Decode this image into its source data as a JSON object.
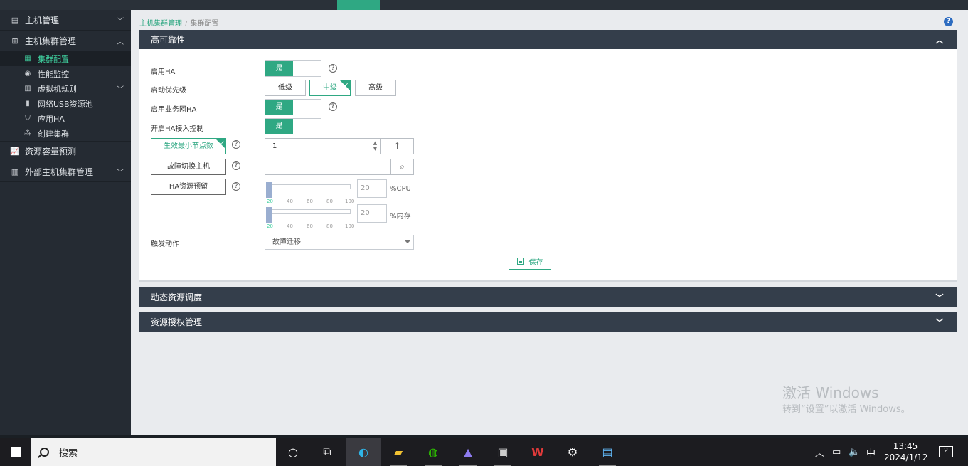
{
  "sidebar": {
    "groups": [
      {
        "label": "主机管理",
        "icon": "server-icon",
        "expanded": false
      },
      {
        "label": "主机集群管理",
        "icon": "cluster-icon",
        "expanded": true
      },
      {
        "label": "资源容量预测",
        "icon": "chart-icon",
        "expanded": false
      },
      {
        "label": "外部主机集群管理",
        "icon": "bars-icon",
        "expanded": false
      }
    ],
    "sub_items": [
      {
        "label": "集群配置",
        "active": true
      },
      {
        "label": "性能监控"
      },
      {
        "label": "虚拟机规则"
      },
      {
        "label": "网络USB资源池"
      },
      {
        "label": "应用HA"
      },
      {
        "label": "创建集群"
      }
    ]
  },
  "breadcrumb": {
    "parent": "主机集群管理",
    "sep": "/",
    "current": "集群配置"
  },
  "help_top": "?",
  "panels": {
    "ha_title": "高可靠性",
    "drs_title": "动态资源调度",
    "auth_title": "资源授权管理"
  },
  "form": {
    "enable_ha": {
      "label": "启用HA",
      "value": "是"
    },
    "priority": {
      "label": "启动优先级",
      "options": [
        "低级",
        "中级",
        "高级"
      ],
      "selected": "中级"
    },
    "business_ha": {
      "label": "启用业务网HA",
      "value": "是"
    },
    "admission": {
      "label": "开启HA接入控制",
      "value": "是"
    },
    "min_nodes": {
      "label": "生效最小节点数",
      "value": "1"
    },
    "failover_host": {
      "label": "故障切换主机",
      "value": ""
    },
    "reserve": {
      "label": "HA资源预留",
      "ticks": [
        "20",
        "40",
        "60",
        "80",
        "100"
      ],
      "cpu": {
        "value": "20",
        "unit": "%CPU"
      },
      "mem": {
        "value": "20",
        "unit": "%内存"
      }
    },
    "trigger": {
      "label": "触发动作",
      "value": "故障迁移"
    },
    "save_label": "保存",
    "help": "?"
  },
  "watermark": {
    "line1": "激活 Windows",
    "line2": "转到“设置”以激活 Windows。"
  },
  "taskbar": {
    "search_label": "搜索",
    "ime": "中",
    "time": "13:45",
    "date": "2024/1/12",
    "notifications": "2"
  },
  "colors": {
    "accent": "#2fa883",
    "panel_header": "#343e4b",
    "sidebar": "#252b33"
  }
}
